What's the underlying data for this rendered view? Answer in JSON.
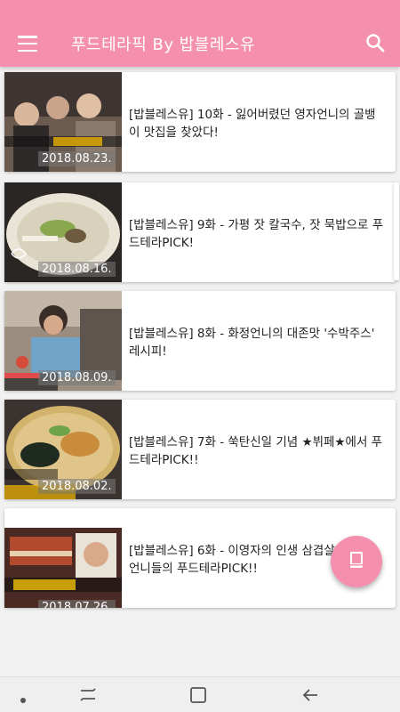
{
  "appbar": {
    "title": "푸드테라픽 By 밥블레스유",
    "menu_icon": "hamburger-menu-icon",
    "search_icon": "search-icon"
  },
  "colors": {
    "accent": "#f48fad",
    "background": "#f1f1f1"
  },
  "episodes": [
    {
      "title": "[밥블레스유] 10화 - 잃어버렸던 영자언니의 골뱅이 맛집을 찾았다!",
      "date": "2018.08.23."
    },
    {
      "title": "[밥블레스유] 9화 - 가평 잣 칼국수, 잣 묵밥으로 푸드테라PICK!",
      "date": "2018.08.16."
    },
    {
      "title": "[밥블레스유] 8화 - 화정언니의 대존맛 '수박주스' 레시피!",
      "date": "2018.08.09."
    },
    {
      "title": "[밥블레스유] 7화 - 쑥탄신일 기념 ★뷔페★에서 푸드테라PICK!!",
      "date": "2018.08.02."
    },
    {
      "title": "[밥블레스유] 6화 - 이영자의 인생 삼겹살과 함께, 언니들의 푸드테라PICK!!",
      "date": "2018.07.26."
    }
  ],
  "fab": {
    "icon": "book-icon"
  },
  "navbar": {
    "items": [
      "dot-icon",
      "recent-apps-icon",
      "home-icon",
      "back-icon"
    ]
  }
}
